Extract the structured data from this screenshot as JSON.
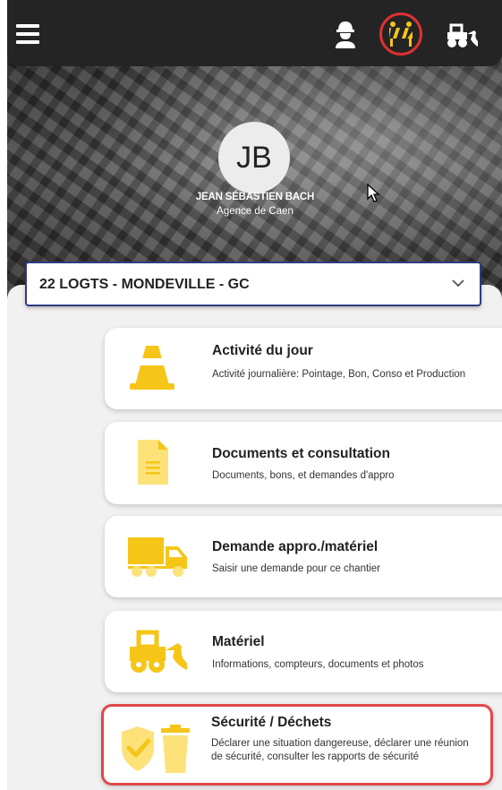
{
  "user": {
    "initials": "JB",
    "name": "JEAN SÉBASTIEN BACH",
    "agency": "Agence de Caen"
  },
  "project": {
    "selected": "22 LOGTS - MONDEVILLE - GC"
  },
  "colors": {
    "accent": "#f5c518",
    "topbar": "#242424",
    "highlight": "#e03030",
    "selector_border": "#2f3c80"
  },
  "icons": [
    "menu-icon",
    "worker-icon",
    "site-icon",
    "equipment-icon",
    "chevron-down-icon"
  ],
  "cards": [
    {
      "title": "Activité du jour",
      "desc": "Activité journalière: Pointage, Bon, Conso et Production",
      "icon": "traffic-cone-icon"
    },
    {
      "title": "Documents et consultation",
      "desc": "Documents, bons, et demandes d'appro",
      "icon": "document-icon"
    },
    {
      "title": "Demande appro./matériel",
      "desc": "Saisir une demande pour ce chantier",
      "icon": "truck-icon"
    },
    {
      "title": "Matériel",
      "desc": "Informations, compteurs, documents et photos",
      "icon": "bulldozer-icon"
    },
    {
      "title": "Sécurité / Déchets",
      "desc": "Déclarer une situation dangereuse, déclarer une réunion de sécurité, consulter les rapports de sécurité",
      "icon": "shield-trash-icon"
    }
  ]
}
